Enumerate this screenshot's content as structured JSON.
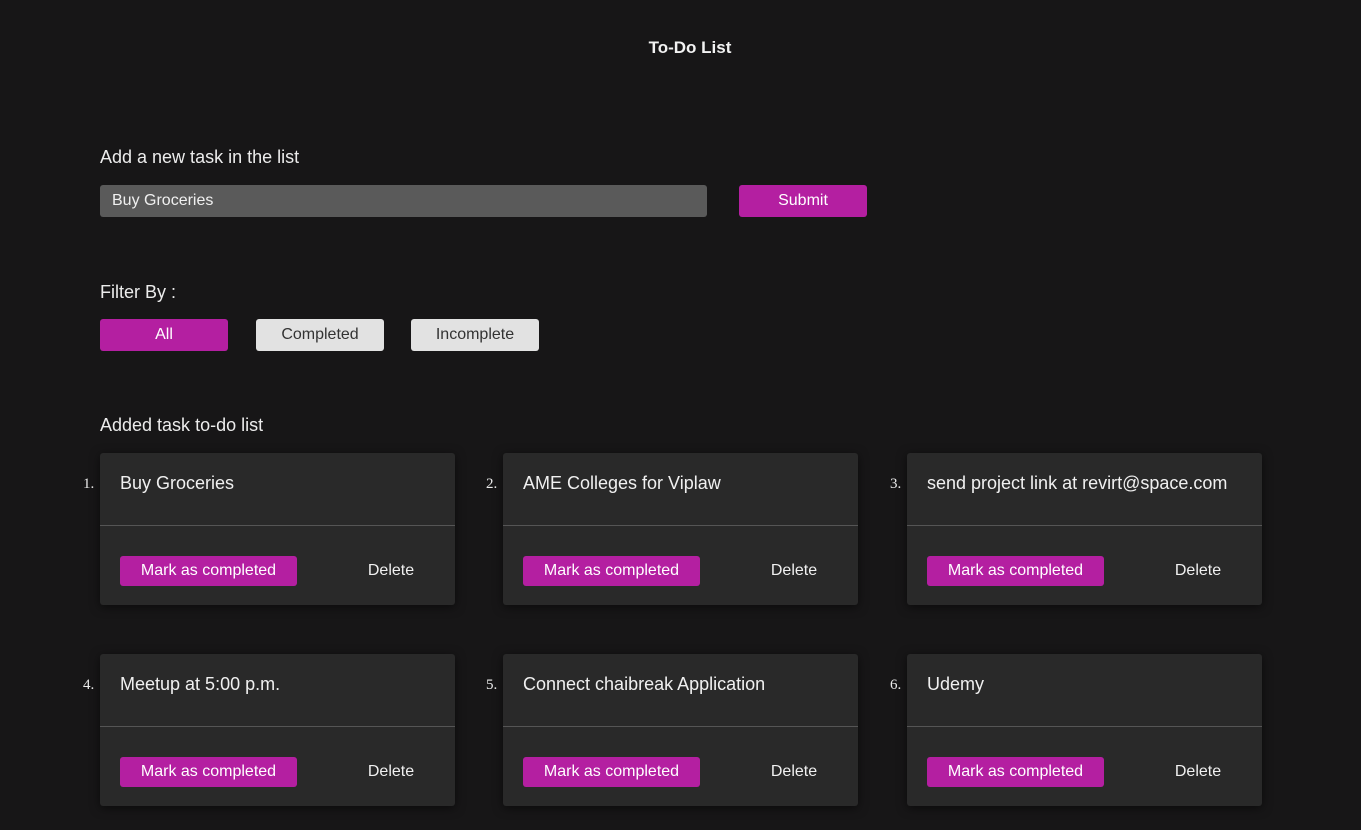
{
  "header": {
    "title": "To-Do List"
  },
  "add_task": {
    "label": "Add a new task in the list",
    "input_value": "Buy Groceries",
    "submit_label": "Submit"
  },
  "filter": {
    "label": "Filter By :",
    "options": [
      "All",
      "Completed",
      "Incomplete"
    ],
    "selected": "All"
  },
  "list": {
    "label": "Added task to-do list",
    "mark_label": "Mark as completed",
    "delete_label": "Delete",
    "tasks": [
      {
        "number": "1.",
        "text": "Buy Groceries"
      },
      {
        "number": "2.",
        "text": "AME Colleges for Viplaw"
      },
      {
        "number": "3.",
        "text": "send project link at revirt@space.com"
      },
      {
        "number": "4.",
        "text": "Meetup at 5:00 p.m."
      },
      {
        "number": "5.",
        "text": "Connect chaibreak Application"
      },
      {
        "number": "6.",
        "text": "Udemy"
      }
    ]
  },
  "colors": {
    "background": "#171617",
    "accent": "#b41fa1",
    "card": "#292929",
    "input": "#5a5a5a",
    "inactive_filter": "#e2e2e2"
  }
}
